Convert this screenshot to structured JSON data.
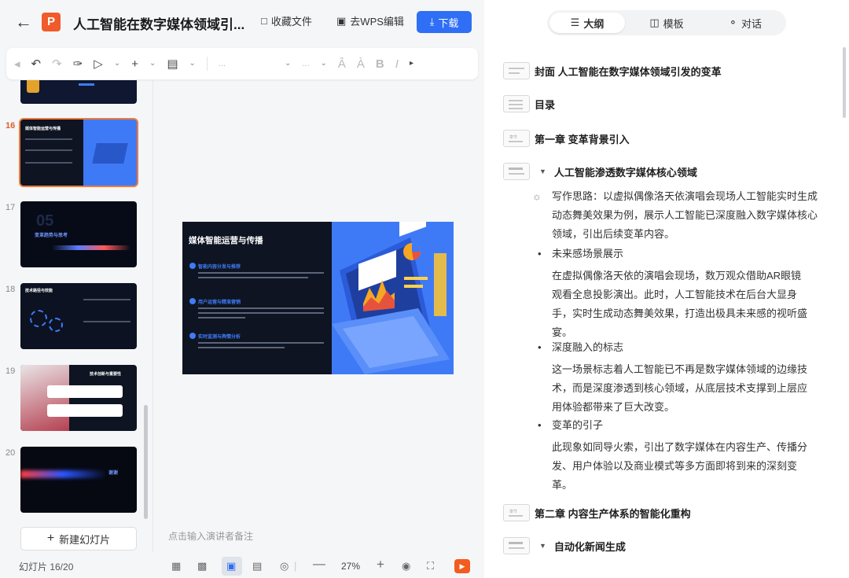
{
  "header": {
    "title": "人工智能在数字媒体领域引...",
    "app_logo": "P",
    "favorite": "收藏文件",
    "wps_edit": "去WPS编辑",
    "download": "下载"
  },
  "toolbar": {
    "font_placeholder": "...",
    "size_placeholder": "..."
  },
  "thumbnails": [
    {
      "num": "16",
      "title": "媒体智能运营与传播",
      "selected": true
    },
    {
      "num": "17",
      "title": "变革趋势与思考",
      "selected": false
    },
    {
      "num": "18",
      "title": "技术路径与效能",
      "selected": false
    },
    {
      "num": "19",
      "title": "技术创新与重要性",
      "selected": false
    },
    {
      "num": "20",
      "title": "谢谢",
      "selected": false
    }
  ],
  "slide": {
    "title": "媒体智能运营与传播",
    "bullets": [
      "智能内容分发与推荐",
      "用户运营与精准营销",
      "实时监测与舆情分析"
    ]
  },
  "new_slide": "新建幻灯片",
  "notes_placeholder": "点击输入演讲者备注",
  "status": {
    "slide_count": "幻灯片 16/20",
    "zoom": "27%"
  },
  "panel": {
    "tabs": [
      "大纲",
      "模板",
      "对话"
    ],
    "outline": {
      "cover": "封面 人工智能在数字媒体领域引发的变革",
      "toc": "目录",
      "chapter1": "第一章 变革背景引入",
      "section1": "人工智能渗透数字媒体核心领域",
      "idea": "写作思路：以虚拟偶像洛天依演唱会现场人工智能实时生成动态舞美效果为例，展示人工智能已深度融入数字媒体核心领域，引出后续变革内容。",
      "points": [
        {
          "title": "未来感场景展示",
          "body": "在虚拟偶像洛天依的演唱会现场，数万观众借助AR眼镜观看全息投影演出。此时，人工智能技术在后台大显身手，实时生成动态舞美效果，打造出极具未来感的视听盛宴。"
        },
        {
          "title": "深度融入的标志",
          "body": "这一场景标志着人工智能已不再是数字媒体领域的边缘技术，而是深度渗透到核心领域，从底层技术支撑到上层应用体验都带来了巨大改变。"
        },
        {
          "title": "变革的引子",
          "body": "此现象如同导火索，引出了数字媒体在内容生产、传播分发、用户体验以及商业模式等多方面即将到来的深刻变革。"
        }
      ],
      "chapter2": "第二章 内容生产体系的智能化重构",
      "section2": "自动化新闻生成",
      "chapter_tag": "章节"
    }
  },
  "colors": {
    "accent": "#2f6ff5",
    "wps_orange": "#ef5b2b",
    "selected_thumb": "#ef7b3a"
  }
}
